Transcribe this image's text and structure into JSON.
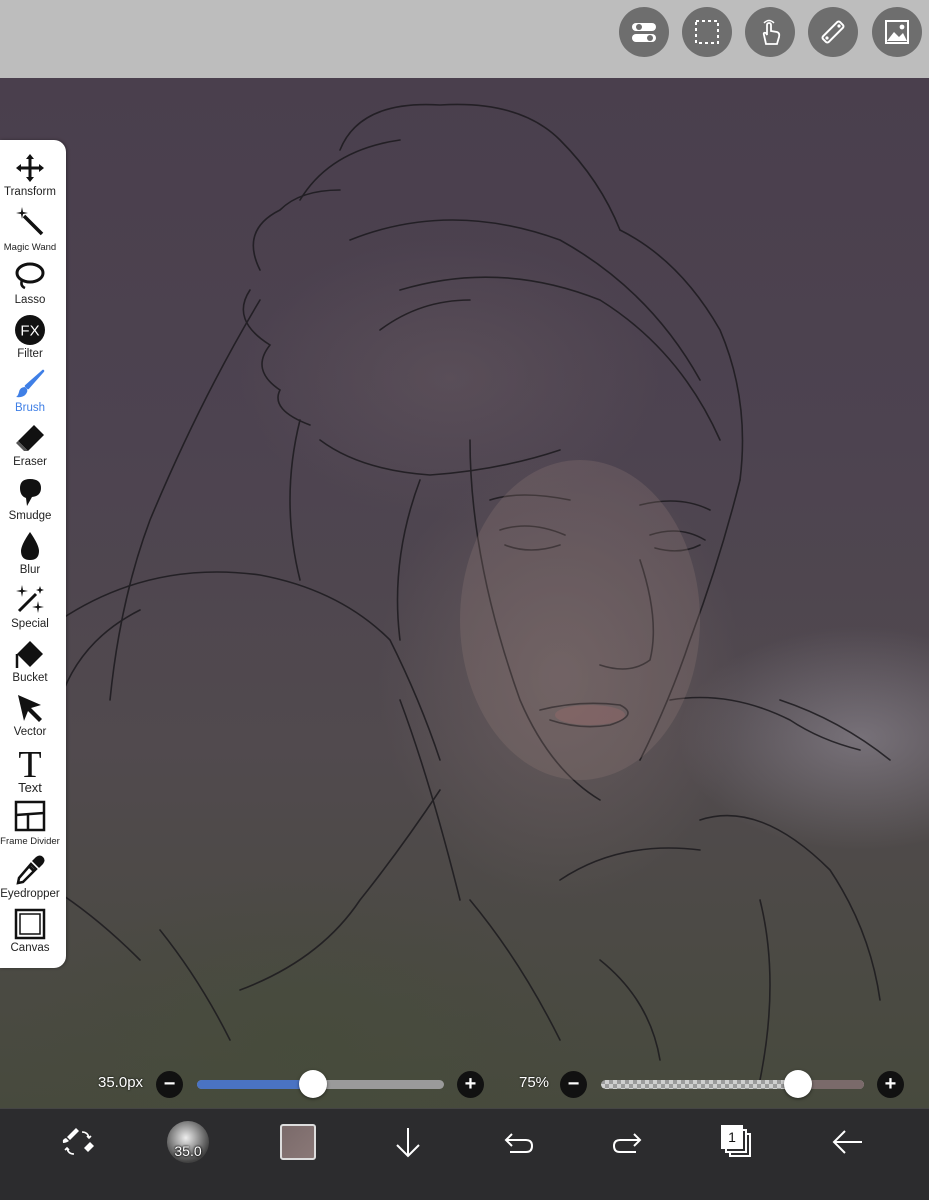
{
  "top_toolbar": {
    "buttons": [
      {
        "name": "toggle-settings",
        "icon": "toggle-switches-icon"
      },
      {
        "name": "selection",
        "icon": "dashed-selection-icon"
      },
      {
        "name": "gesture",
        "icon": "touch-hand-icon"
      },
      {
        "name": "ruler",
        "icon": "ruler-icon"
      },
      {
        "name": "material",
        "icon": "image-gallery-icon"
      }
    ]
  },
  "tools": [
    {
      "label": "Transform",
      "icon": "move-arrows-icon"
    },
    {
      "label": "Magic Wand",
      "icon": "magic-wand-icon"
    },
    {
      "label": "Lasso",
      "icon": "lasso-icon"
    },
    {
      "label": "Filter",
      "icon": "fx-icon"
    },
    {
      "label": "Brush",
      "icon": "brush-icon",
      "active": true
    },
    {
      "label": "Eraser",
      "icon": "eraser-icon"
    },
    {
      "label": "Smudge",
      "icon": "smudge-icon"
    },
    {
      "label": "Blur",
      "icon": "droplet-icon"
    },
    {
      "label": "Special",
      "icon": "sparkles-icon"
    },
    {
      "label": "Bucket",
      "icon": "bucket-icon"
    },
    {
      "label": "Vector",
      "icon": "arrow-cursor-icon"
    },
    {
      "label": "Text",
      "icon": "text-T-icon"
    },
    {
      "label": "Frame Divider",
      "icon": "frame-divider-icon"
    },
    {
      "label": "Eyedropper",
      "icon": "eyedropper-icon"
    },
    {
      "label": "Canvas",
      "icon": "canvas-square-icon"
    }
  ],
  "brush_size": {
    "value_label": "35.0px",
    "fraction": 0.47,
    "minus": "−",
    "plus": "+"
  },
  "opacity": {
    "value_label": "75%",
    "fraction": 0.75,
    "minus": "−",
    "plus": "+"
  },
  "bottom_toolbar": {
    "brush_preview_label": "35.0",
    "layer_count": "1",
    "icons": [
      "swap-brush-eraser-icon",
      "brush-preview-icon",
      "color-swatch-icon",
      "import-down-arrow-icon",
      "undo-icon",
      "redo-icon",
      "layers-icon",
      "back-arrow-icon"
    ]
  },
  "colors": {
    "accent": "#3f7fe6",
    "top_bar": "#bdbdbd",
    "bottom_bar": "#2c2c2e",
    "swatch": "#7a6a6a"
  }
}
